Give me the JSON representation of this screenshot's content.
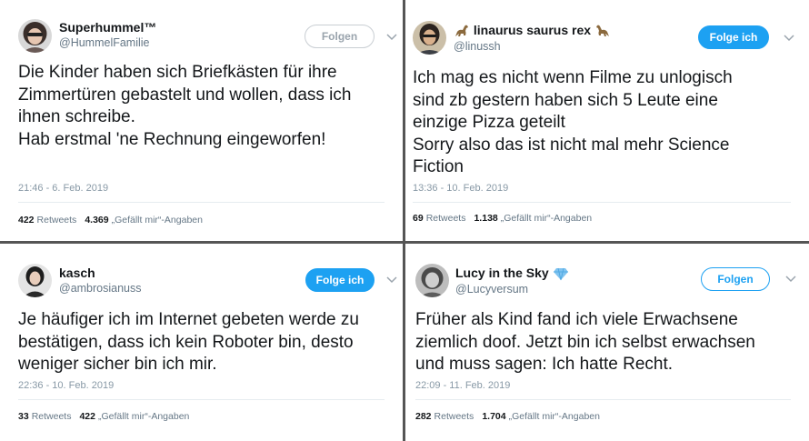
{
  "tweets": [
    {
      "name": "Superhummel™",
      "handle": "@HummelFamilie",
      "follow_label": "Folgen",
      "text": "Die Kinder haben sich Briefkästen für ihre\nZimmertüren gebastelt und wollen, dass ich\nihnen schreibe.\nHab erstmal 'ne Rechnung eingeworfen!",
      "timestamp": "21:46 - 6. Feb. 2019",
      "retweets": "422",
      "retweets_label": "Retweets",
      "likes": "4.369",
      "likes_label": "„Gefällt mir“-Angaben"
    },
    {
      "name": "linaurus saurus rex",
      "handle": "@linussh",
      "follow_label": "Folge ich",
      "text": "Ich mag es nicht wenn Filme zu unlogisch\nsind zb gestern haben sich 5 Leute eine\neinzige Pizza geteilt\nSorry also das ist nicht mal mehr Science\nFiction",
      "timestamp": "13:36 - 10. Feb. 2019",
      "retweets": "69",
      "retweets_label": "Retweets",
      "likes": "1.138",
      "likes_label": "„Gefällt mir“-Angaben"
    },
    {
      "name": "kasch",
      "handle": "@ambrosianuss",
      "follow_label": "Folge ich",
      "text": "Je häufiger ich im Internet gebeten werde zu\nbestätigen, dass ich kein Roboter bin, desto\nweniger sicher bin ich mir.",
      "timestamp": "22:36 - 10. Feb. 2019",
      "retweets": "33",
      "retweets_label": "Retweets",
      "likes": "422",
      "likes_label": "„Gefällt mir“-Angaben"
    },
    {
      "name": "Lucy in the Sky",
      "handle": "@Lucyversum",
      "follow_label": "Folgen",
      "text": "Früher als Kind fand ich viele Erwachsene\nziemlich doof. Jetzt bin ich selbst erwachsen\nund muss sagen: Ich hatte Recht.",
      "timestamp": "22:09 - 11. Feb. 2019",
      "retweets": "282",
      "retweets_label": "Retweets",
      "likes": "1.704",
      "likes_label": "„Gefällt mir“-Angaben"
    }
  ],
  "colors": {
    "twitter_blue": "#1da1f2",
    "text": "#14171a",
    "muted": "#657786"
  },
  "icons": [
    "dinosaur-icon",
    "diamond-icon",
    "chevron-down-icon",
    "avatar"
  ]
}
